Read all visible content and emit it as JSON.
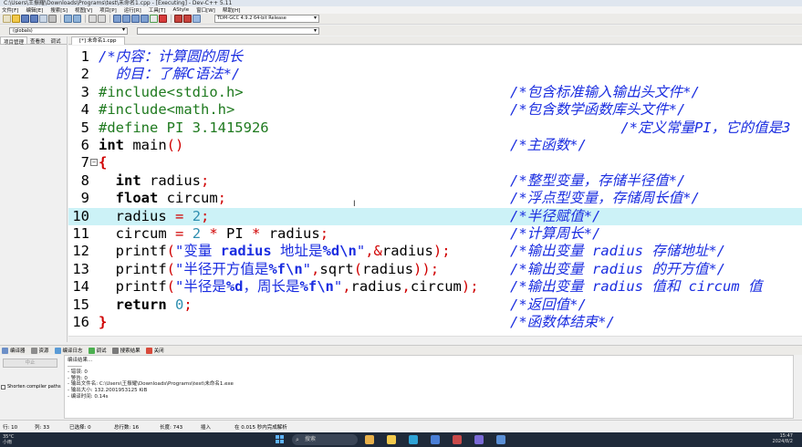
{
  "window": {
    "title": "C:\\Users\\王振耀\\Downloads\\Programs\\test\\未命名1.cpp - [Executing] - Dev-C++ 5.11"
  },
  "menu": [
    "文件[F]",
    "编辑[E]",
    "搜索[S]",
    "视图[V]",
    "项目[P]",
    "运行[R]",
    "工具[T]",
    "AStyle",
    "窗口[W]",
    "帮助[H]"
  ],
  "compiler": "TDM-GCC 4.9.2 64-bit Release",
  "scope": "(globals)",
  "left_panel": {
    "tabs": [
      "项目管理",
      "查看类",
      "调试"
    ]
  },
  "editor": {
    "tab": "[*] 未命名1.cpp",
    "highlight_line": 10,
    "lines": [
      {
        "n": "1",
        "fold": "",
        "tokens": [
          {
            "t": "/*内容：计算圆的周长",
            "c": "c-com"
          }
        ],
        "comment": ""
      },
      {
        "n": "2",
        "fold": "",
        "tokens": [
          {
            "t": "  的目：了解C语法*/",
            "c": "c-com"
          }
        ],
        "comment": ""
      },
      {
        "n": "3",
        "fold": "",
        "tokens": [
          {
            "t": "#include<stdio.h>",
            "c": "c-pre"
          }
        ],
        "comment": "/*包含标准输入输出头文件*/"
      },
      {
        "n": "4",
        "fold": "",
        "tokens": [
          {
            "t": "#include<math.h>",
            "c": "c-pre"
          }
        ],
        "comment": "/*包含数学函数库头文件*/"
      },
      {
        "n": "5",
        "fold": "",
        "tokens": [
          {
            "t": "#define PI 3.1415926",
            "c": "c-pre"
          }
        ],
        "comment": "             /*定义常量PI，它的值是3"
      },
      {
        "n": "6",
        "fold": "",
        "tokens": [
          {
            "t": "int",
            "c": "c-kw"
          },
          {
            "t": " main",
            "c": "c-id"
          },
          {
            "t": "()",
            "c": "c-op"
          }
        ],
        "comment": "/*主函数*/"
      },
      {
        "n": "7",
        "fold": "−",
        "tokens": [
          {
            "t": "{",
            "c": "c-brace"
          }
        ],
        "comment": ""
      },
      {
        "n": "8",
        "fold": "",
        "tokens": [
          {
            "t": "  ",
            "c": "c-id"
          },
          {
            "t": "int",
            "c": "c-kw"
          },
          {
            "t": " radius",
            "c": "c-id"
          },
          {
            "t": ";",
            "c": "c-op"
          }
        ],
        "comment": "/*整型变量，存储半径值*/"
      },
      {
        "n": "9",
        "fold": "",
        "tokens": [
          {
            "t": "  ",
            "c": "c-id"
          },
          {
            "t": "float",
            "c": "c-kw"
          },
          {
            "t": " circum",
            "c": "c-id"
          },
          {
            "t": ";",
            "c": "c-op"
          }
        ],
        "comment": "/*浮点型变量，存储周长值*/"
      },
      {
        "n": "10",
        "fold": "",
        "tokens": [
          {
            "t": "  radius ",
            "c": "c-id"
          },
          {
            "t": "=",
            "c": "c-op"
          },
          {
            "t": " ",
            "c": "c-id"
          },
          {
            "t": "2",
            "c": "c-num"
          },
          {
            "t": ";",
            "c": "c-op"
          }
        ],
        "comment": "/*半径赋值*/"
      },
      {
        "n": "11",
        "fold": "",
        "tokens": [
          {
            "t": "  circum ",
            "c": "c-id"
          },
          {
            "t": "=",
            "c": "c-op"
          },
          {
            "t": " ",
            "c": "c-id"
          },
          {
            "t": "2",
            "c": "c-num"
          },
          {
            "t": " ",
            "c": "c-id"
          },
          {
            "t": "*",
            "c": "c-op"
          },
          {
            "t": " PI ",
            "c": "c-id"
          },
          {
            "t": "*",
            "c": "c-op"
          },
          {
            "t": " radius",
            "c": "c-id"
          },
          {
            "t": ";",
            "c": "c-op"
          }
        ],
        "comment": "/*计算周长*/"
      },
      {
        "n": "12",
        "fold": "",
        "tokens": [
          {
            "t": "  printf",
            "c": "c-id"
          },
          {
            "t": "(",
            "c": "c-op"
          },
          {
            "t": "\"变量 ",
            "c": "c-str"
          },
          {
            "t": "radius",
            "c": "c-fmt"
          },
          {
            "t": " 地址是",
            "c": "c-str"
          },
          {
            "t": "%d\\n",
            "c": "c-fmt"
          },
          {
            "t": "\"",
            "c": "c-str"
          },
          {
            "t": ",&",
            "c": "c-op"
          },
          {
            "t": "radius",
            "c": "c-id"
          },
          {
            "t": ");",
            "c": "c-op"
          }
        ],
        "comment": "/*输出变量 radius 存储地址*/"
      },
      {
        "n": "13",
        "fold": "",
        "tokens": [
          {
            "t": "  printf",
            "c": "c-id"
          },
          {
            "t": "(",
            "c": "c-op"
          },
          {
            "t": "\"半径开方值是",
            "c": "c-str"
          },
          {
            "t": "%f\\n",
            "c": "c-fmt"
          },
          {
            "t": "\"",
            "c": "c-str"
          },
          {
            "t": ",",
            "c": "c-op"
          },
          {
            "t": "sqrt",
            "c": "c-id"
          },
          {
            "t": "(",
            "c": "c-op"
          },
          {
            "t": "radius",
            "c": "c-id"
          },
          {
            "t": "));",
            "c": "c-op"
          }
        ],
        "comment": "/*输出变量 radius 的开方值*/"
      },
      {
        "n": "14",
        "fold": "",
        "tokens": [
          {
            "t": "  printf",
            "c": "c-id"
          },
          {
            "t": "(",
            "c": "c-op"
          },
          {
            "t": "\"半径是",
            "c": "c-str"
          },
          {
            "t": "%d",
            "c": "c-fmt"
          },
          {
            "t": "，周长是",
            "c": "c-str"
          },
          {
            "t": "%f\\n",
            "c": "c-fmt"
          },
          {
            "t": "\"",
            "c": "c-str"
          },
          {
            "t": ",",
            "c": "c-op"
          },
          {
            "t": "radius",
            "c": "c-id"
          },
          {
            "t": ",",
            "c": "c-op"
          },
          {
            "t": "circum",
            "c": "c-id"
          },
          {
            "t": ");",
            "c": "c-op"
          }
        ],
        "comment": "/*输出变量 radius 值和 circum 值"
      },
      {
        "n": "15",
        "fold": "",
        "tokens": [
          {
            "t": "  ",
            "c": "c-id"
          },
          {
            "t": "return",
            "c": "c-kw"
          },
          {
            "t": " ",
            "c": "c-id"
          },
          {
            "t": "0",
            "c": "c-num"
          },
          {
            "t": ";",
            "c": "c-op"
          }
        ],
        "comment": "/*返回值*/"
      },
      {
        "n": "16",
        "fold": "",
        "tokens": [
          {
            "t": "}",
            "c": "c-brace"
          }
        ],
        "comment": "/*函数体结束*/"
      }
    ]
  },
  "bottom_tabs": [
    "编译器",
    "资源",
    "编译日志",
    "调试",
    "搜索结果",
    "关闭"
  ],
  "bottom_left": {
    "stop_label": "中止",
    "shorten_label": "Shorten compiler paths"
  },
  "output": [
    "编译结果...",
    "--------",
    "- 错误: 0",
    "- 警告: 0",
    "- 输出文件名: C:\\Users\\王振耀\\Downloads\\Programs\\test\\未命名1.exe",
    "- 输出大小: 132.2001953125 KiB",
    "- 编译时间: 0.14s"
  ],
  "status": {
    "row": "行: 10",
    "col": "列: 33",
    "selected": "已选择: 0",
    "total_lines": "总行数: 16",
    "length": "长度: 743",
    "mode": "插入",
    "parse": "在 0.015 秒内完成解析"
  },
  "taskbar": {
    "temp": "35°C",
    "weather": "小雨",
    "search": "搜索",
    "time": "15:47",
    "date": "2024/8/2"
  }
}
